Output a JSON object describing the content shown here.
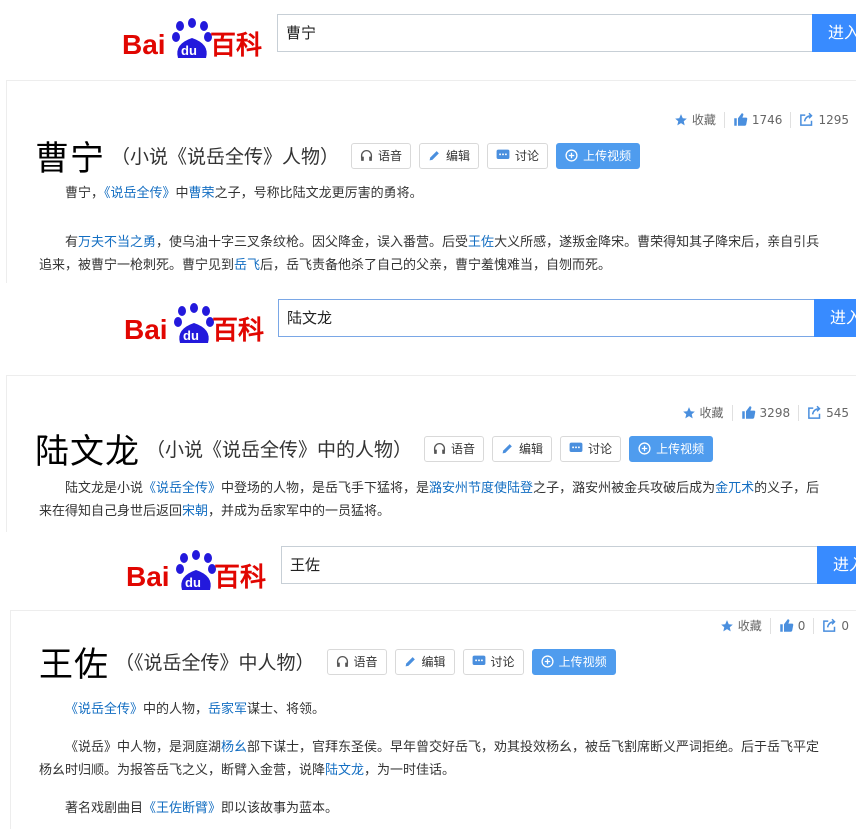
{
  "logo_text": "Bai du 百科",
  "search_button": "进入",
  "colors": {
    "brand_red": "#e10601",
    "brand_blue": "#2319dc",
    "button_blue": "#388bff",
    "link": "#136ec2"
  },
  "entries": [
    {
      "query": "曹宁",
      "title": "曹宁",
      "subtitle": "（小说《说岳全传》人物）",
      "stats": {
        "collect_label": "收藏",
        "likes": "1746",
        "shares": "1295"
      },
      "buttons": {
        "voice": "语音",
        "edit": "编辑",
        "discuss": "讨论",
        "upload": "上传视频"
      },
      "paragraphs": [
        [
          {
            "t": "曹宁，"
          },
          {
            "t": "《说岳全传》",
            "link": true
          },
          {
            "t": "中"
          },
          {
            "t": "曹荣",
            "link": true
          },
          {
            "t": "之子，号称比陆文龙更厉害的勇将。"
          }
        ],
        [
          {
            "t": "有"
          },
          {
            "t": "万夫不当之勇",
            "link": true
          },
          {
            "t": "，使乌油十字三叉条纹枪。因父降金，误入番营。后受"
          },
          {
            "t": "王佐",
            "link": true
          },
          {
            "t": "大义所感，遂叛金降宋。曹荣得知其子降宋后，亲自引兵追来，被曹宁一枪刺死。曹宁见到"
          },
          {
            "t": "岳飞",
            "link": true
          },
          {
            "t": "后，岳飞责备他杀了自己的父亲，曹宁羞愧难当，自刎而死。"
          }
        ]
      ]
    },
    {
      "query": "陆文龙",
      "title": "陆文龙",
      "subtitle": "（小说《说岳全传》中的人物）",
      "stats": {
        "collect_label": "收藏",
        "likes": "3298",
        "shares": "545"
      },
      "buttons": {
        "voice": "语音",
        "edit": "编辑",
        "discuss": "讨论",
        "upload": "上传视频"
      },
      "paragraphs": [
        [
          {
            "t": "陆文龙是小说"
          },
          {
            "t": "《说岳全传》",
            "link": true
          },
          {
            "t": "中登场的人物，是岳飞手下猛将，是"
          },
          {
            "t": "潞安州节度使陆登",
            "link": true
          },
          {
            "t": "之子，潞安州被金兵攻破后成为"
          },
          {
            "t": "金兀术",
            "link": true
          },
          {
            "t": "的义子，后来在得知自己身世后返回"
          },
          {
            "t": "宋朝",
            "link": true
          },
          {
            "t": "，并成为岳家军中的一员猛将。"
          }
        ]
      ]
    },
    {
      "query": "王佐",
      "title": "王佐",
      "subtitle": "（《说岳全传》中人物）",
      "stats": {
        "collect_label": "收藏",
        "likes": "0",
        "shares": "0"
      },
      "buttons": {
        "voice": "语音",
        "edit": "编辑",
        "discuss": "讨论",
        "upload": "上传视频"
      },
      "paragraphs": [
        [
          {
            "t": "《说岳全传》",
            "link": true
          },
          {
            "t": "中的人物，"
          },
          {
            "t": "岳家军",
            "link": true
          },
          {
            "t": "谋士、将领。"
          }
        ],
        [
          {
            "t": "《说岳》中人物，是洞庭湖"
          },
          {
            "t": "杨幺",
            "link": true
          },
          {
            "t": "部下谋士，官拜东圣侯。早年曾交好岳飞，劝其投效杨幺，被岳飞割席断义严词拒绝。后于岳飞平定杨幺时归顺。为报答岳飞之义，断臂入金营，说降"
          },
          {
            "t": "陆文龙",
            "link": true
          },
          {
            "t": "，为一时佳话。"
          }
        ],
        [
          {
            "t": "著名戏剧曲目"
          },
          {
            "t": "《王佐断臂》",
            "link": true
          },
          {
            "t": "即以该故事为蓝本。"
          }
        ]
      ]
    }
  ]
}
